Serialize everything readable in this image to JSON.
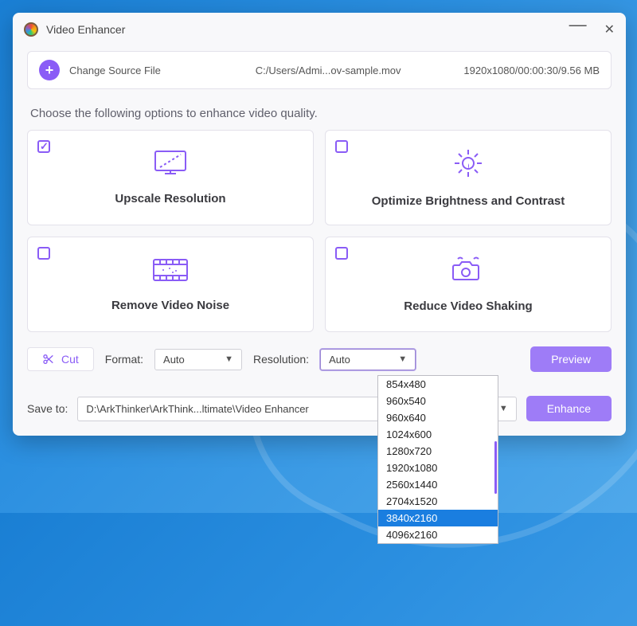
{
  "window": {
    "title": "Video Enhancer"
  },
  "source": {
    "change_label": "Change Source File",
    "path": "C:/Users/Admi...ov-sample.mov",
    "meta": "1920x1080/00:00:30/9.56 MB"
  },
  "prompt": "Choose the following options to enhance video quality.",
  "cards": {
    "upscale": {
      "label": "Upscale Resolution",
      "checked": true
    },
    "brightness": {
      "label": "Optimize Brightness and Contrast",
      "checked": false
    },
    "denoise": {
      "label": "Remove Video Noise",
      "checked": false
    },
    "deshake": {
      "label": "Reduce Video Shaking",
      "checked": false
    }
  },
  "controls": {
    "cut": "Cut",
    "format_label": "Format:",
    "format_value": "Auto",
    "resolution_label": "Resolution:",
    "resolution_value": "Auto",
    "preview": "Preview"
  },
  "resolution_options": [
    "854x480",
    "960x540",
    "960x640",
    "1024x600",
    "1280x720",
    "1920x1080",
    "2560x1440",
    "2704x1520",
    "3840x2160",
    "4096x2160"
  ],
  "resolution_selected": "3840x2160",
  "save": {
    "label": "Save to:",
    "path": "D:\\ArkThinker\\ArkThink...ltimate\\Video Enhancer",
    "enhance": "Enhance"
  }
}
